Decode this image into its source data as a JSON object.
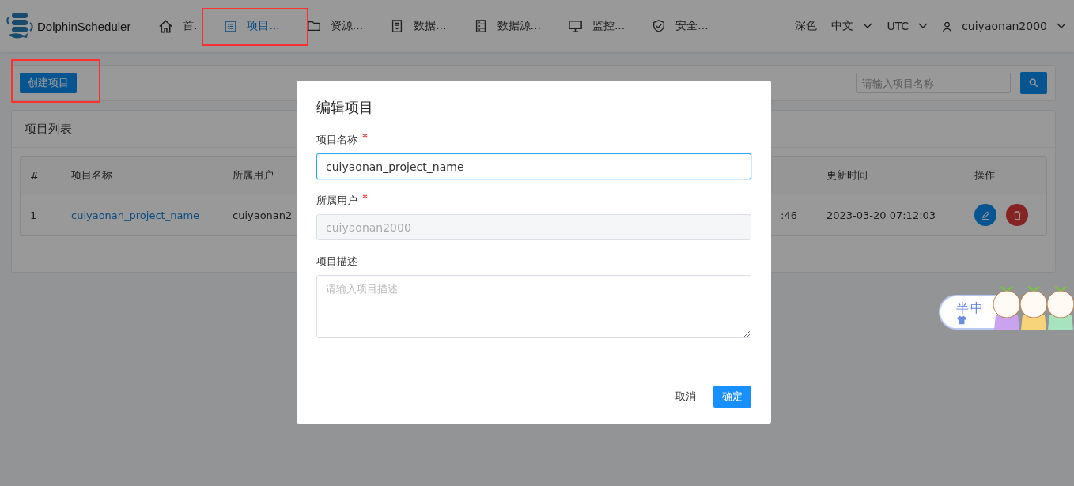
{
  "header": {
    "logo": "DolphinScheduler",
    "nav": [
      {
        "label": "首.",
        "kind": "home",
        "selected": false,
        "highlighted": false
      },
      {
        "label": "项目...",
        "kind": "list",
        "selected": true,
        "highlighted": true
      },
      {
        "label": "资源...",
        "kind": "folder",
        "selected": false,
        "highlighted": false
      },
      {
        "label": "数据...",
        "kind": "doc",
        "selected": false,
        "highlighted": false
      },
      {
        "label": "数据源...",
        "kind": "server",
        "selected": false,
        "highlighted": false
      },
      {
        "label": "监控...",
        "kind": "monitor",
        "selected": false,
        "highlighted": false
      },
      {
        "label": "安全...",
        "kind": "shield",
        "selected": false,
        "highlighted": false
      }
    ],
    "theme": "深色",
    "language": "中文",
    "timezone": "UTC",
    "user": "cuiyaonan2000"
  },
  "toolbar": {
    "create_button": {
      "label": "创建项目",
      "highlighted": true
    },
    "search": {
      "placeholder": "请输入项目名称"
    }
  },
  "project_list": {
    "title": "项目列表",
    "columns": {
      "index": "#",
      "project_name": "项目名称",
      "user": "所属用户",
      "update_time": "更新时间",
      "actions": "操作"
    },
    "rows": [
      {
        "index": "1",
        "project_name": "cuiyaonan_project_name",
        "user": "cuiyaonan2",
        "column_4": ":46",
        "update_time": "2023-03-20 07:12:03"
      }
    ]
  },
  "dialog": {
    "title": "编辑项目",
    "fields": [
      {
        "kind": "input",
        "label": "项目名称",
        "required": true,
        "value": "cuiyaonan_project_name",
        "focused": true,
        "disabled": false
      },
      {
        "kind": "input",
        "label": "所属用户",
        "required": true,
        "value": "cuiyaonan2000",
        "focused": false,
        "disabled": true
      },
      {
        "kind": "textarea",
        "label": "项目描述",
        "required": false,
        "placeholder": "请输入项目描述"
      }
    ],
    "cancel": "取消",
    "confirm": "确定"
  },
  "ime_toolbar": {
    "width_mode": "半",
    "language": "中"
  }
}
